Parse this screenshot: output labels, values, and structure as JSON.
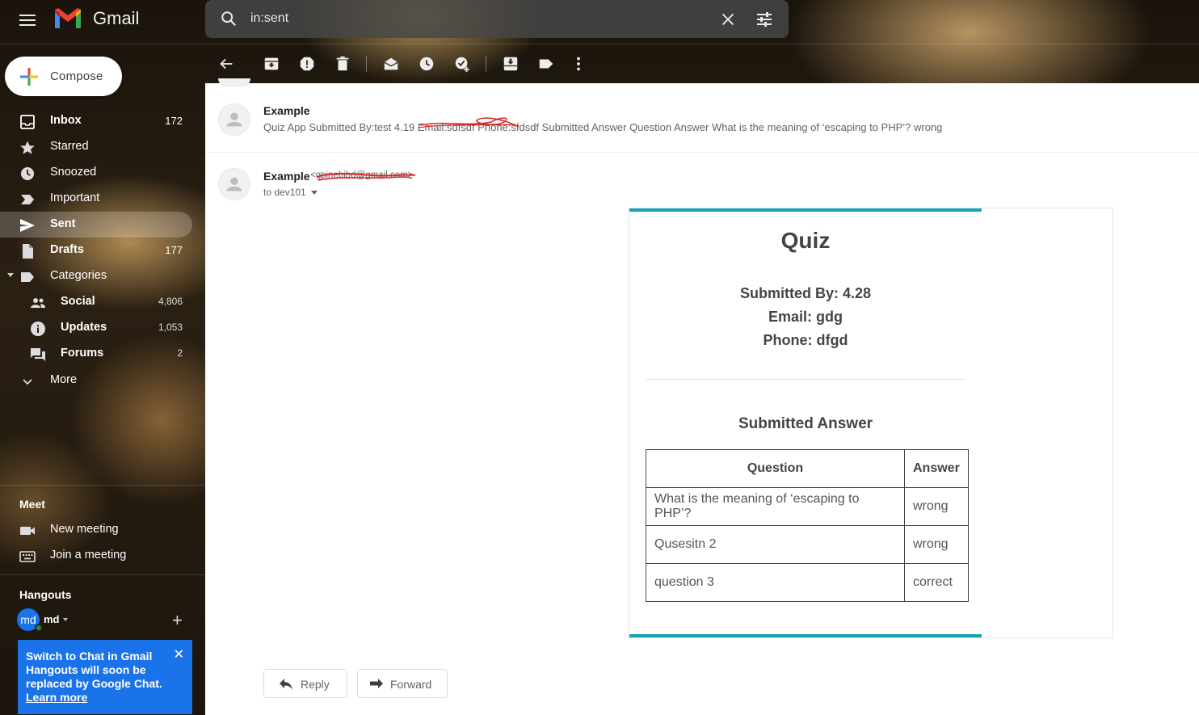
{
  "app": {
    "name": "Gmail"
  },
  "search": {
    "query": "in:sent"
  },
  "compose": {
    "label": "Compose"
  },
  "nav": {
    "inbox": {
      "label": "Inbox",
      "count": "172"
    },
    "starred": {
      "label": "Starred"
    },
    "snoozed": {
      "label": "Snoozed"
    },
    "important": {
      "label": "Important"
    },
    "sent": {
      "label": "Sent"
    },
    "drafts": {
      "label": "Drafts",
      "count": "177"
    },
    "categories": {
      "label": "Categories"
    },
    "social": {
      "label": "Social",
      "count": "4,806"
    },
    "updates": {
      "label": "Updates",
      "count": "1,053"
    },
    "forums": {
      "label": "Forums",
      "count": "2"
    },
    "more": {
      "label": "More"
    }
  },
  "meet": {
    "heading": "Meet",
    "new_meeting": "New meeting",
    "join_meeting": "Join a meeting"
  },
  "hangouts": {
    "heading": "Hangouts",
    "avatar_initials": "md",
    "user": "md",
    "promo_title": "Switch to Chat in Gmail",
    "promo_body": "Hangouts will soon be replaced by Google Chat.",
    "promo_link": "Learn more"
  },
  "thread": {
    "message1": {
      "sender": "Example",
      "snippet": "Quiz App Submitted By:test 4.19 Email:sdfsdf Phone:sfdsdf Submitted Answer Question Answer What is the meaning of ‘escaping to PHP’? wrong"
    },
    "message2": {
      "sender": "Example",
      "sender_email": "<gpinebibd@gmail.com>",
      "to": "to dev101"
    }
  },
  "email": {
    "title": "Quiz",
    "submitted_by": "Submitted By: 4.28",
    "email_line": "Email: gdg",
    "phone_line": "Phone: dfgd",
    "answers_title": "Submitted Answer",
    "table": {
      "headers": [
        "Question",
        "Answer"
      ],
      "rows": [
        [
          "What is the meaning of ‘escaping to PHP’?",
          "wrong"
        ],
        [
          "Qusesitn 2",
          "wrong"
        ],
        [
          "question 3",
          "correct"
        ]
      ]
    }
  },
  "actions": {
    "reply": "Reply",
    "forward": "Forward"
  },
  "icons": {
    "menu": "menu-icon",
    "search": "search-icon",
    "clear": "close-icon",
    "tune": "tune-icon",
    "back": "arrow-back-icon",
    "archive": "archive-icon",
    "spam": "report-spam-icon",
    "delete": "trash-icon",
    "mark_unread": "mark-unread-icon",
    "snooze": "clock-icon",
    "add_task": "add-task-icon",
    "move_to": "move-to-icon",
    "label": "label-icon",
    "more": "more-vert-icon"
  },
  "colors": {
    "accent_teal": "#17a2b8",
    "brand_blue": "#1a73e8",
    "gmail_red": "#ea4335"
  }
}
